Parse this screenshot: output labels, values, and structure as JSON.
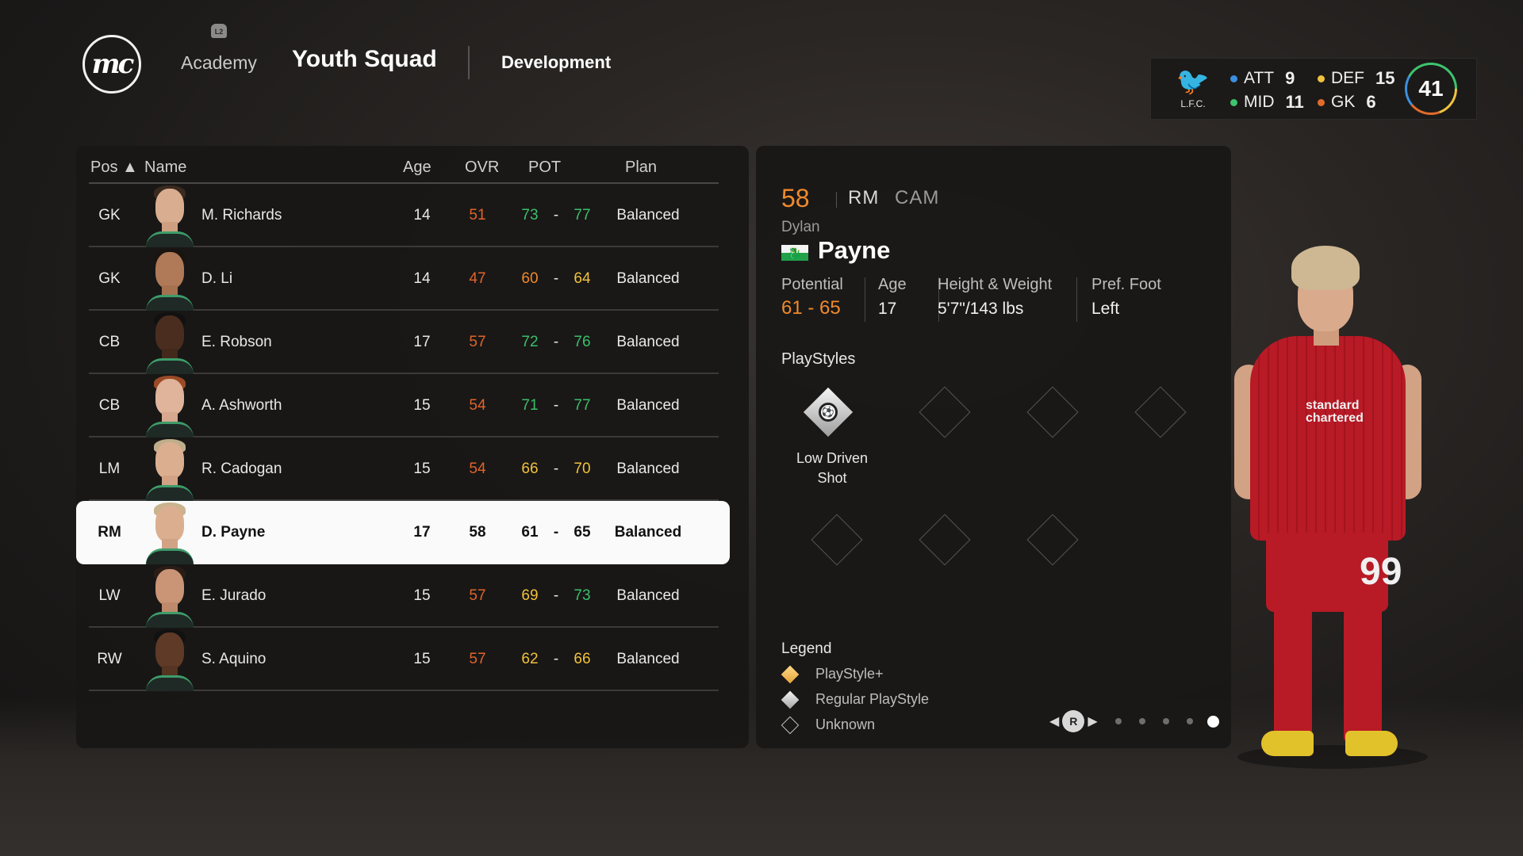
{
  "header": {
    "logo_text": "mc",
    "tabs": {
      "academy": "Academy",
      "academy_badge": "L2",
      "youth_squad": "Youth Squad",
      "development": "Development"
    }
  },
  "club": {
    "crest_label": "L.F.C.",
    "stats": [
      {
        "label": "ATT",
        "value": "9",
        "color": "#3b8fe0"
      },
      {
        "label": "DEF",
        "value": "15",
        "color": "#f0c23e"
      },
      {
        "label": "MID",
        "value": "11",
        "color": "#3ec46d"
      },
      {
        "label": "GK",
        "value": "6",
        "color": "#e26b2a"
      }
    ],
    "rating": "41"
  },
  "table": {
    "headers": {
      "pos": "Pos",
      "name": "Name",
      "age": "Age",
      "ovr": "OVR",
      "pot": "POT",
      "plan": "Plan"
    },
    "rows": [
      {
        "pos": "GK",
        "name": "M. Richards",
        "age": "14",
        "ovr": "51",
        "pot_lo": "73",
        "pot_hi": "77",
        "plan": "Balanced"
      },
      {
        "pos": "GK",
        "name": "D. Li",
        "age": "14",
        "ovr": "47",
        "pot_lo": "60",
        "pot_hi": "64",
        "plan": "Balanced"
      },
      {
        "pos": "CB",
        "name": "E. Robson",
        "age": "17",
        "ovr": "57",
        "pot_lo": "72",
        "pot_hi": "76",
        "plan": "Balanced"
      },
      {
        "pos": "CB",
        "name": "A. Ashworth",
        "age": "15",
        "ovr": "54",
        "pot_lo": "71",
        "pot_hi": "77",
        "plan": "Balanced"
      },
      {
        "pos": "LM",
        "name": "R. Cadogan",
        "age": "15",
        "ovr": "54",
        "pot_lo": "66",
        "pot_hi": "70",
        "plan": "Balanced"
      },
      {
        "pos": "RM",
        "name": "D. Payne",
        "age": "17",
        "ovr": "58",
        "pot_lo": "61",
        "pot_hi": "65",
        "plan": "Balanced"
      },
      {
        "pos": "LW",
        "name": "E. Jurado",
        "age": "15",
        "ovr": "57",
        "pot_lo": "69",
        "pot_hi": "73",
        "plan": "Balanced"
      },
      {
        "pos": "RW",
        "name": "S. Aquino",
        "age": "15",
        "ovr": "57",
        "pot_lo": "62",
        "pot_hi": "66",
        "plan": "Balanced"
      }
    ]
  },
  "detail": {
    "ovr": "58",
    "positions": [
      "RM",
      "CAM"
    ],
    "first_name": "Dylan",
    "last_name": "Payne",
    "labels": {
      "potential": "Potential",
      "age": "Age",
      "height_weight": "Height & Weight",
      "pref_foot": "Pref. Foot"
    },
    "potential": "61 - 65",
    "age": "17",
    "height_weight": "5'7\"/143 lbs",
    "pref_foot": "Left",
    "playstyles_title": "PlayStyles",
    "playstyle_name_line1": "Low Driven",
    "playstyle_name_line2": "Shot",
    "legend_title": "Legend",
    "legend": {
      "plus": "PlayStyle+",
      "regular": "Regular PlayStyle",
      "unknown": "Unknown"
    },
    "pager_button": "R"
  },
  "player_model": {
    "shirt_number": "99",
    "sponsor": "standard chartered"
  }
}
